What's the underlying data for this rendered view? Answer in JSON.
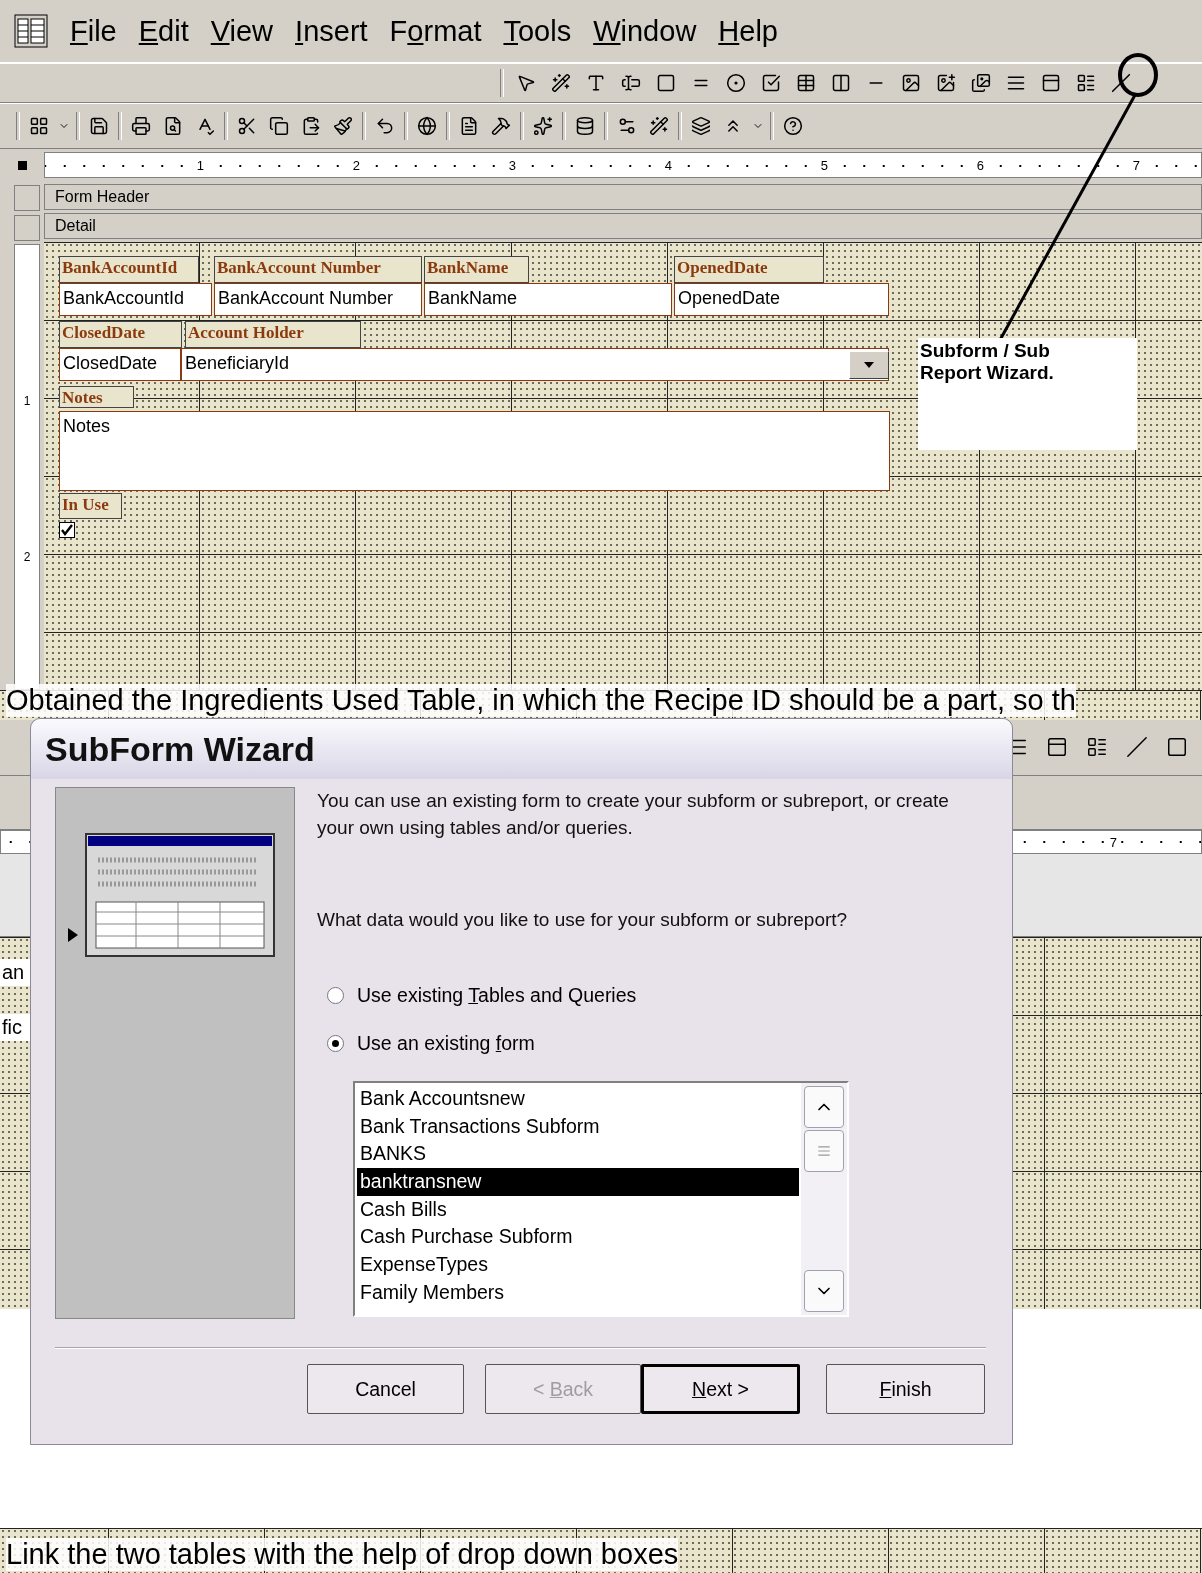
{
  "menu_bar": {
    "items": [
      {
        "key": "F",
        "after": "ile"
      },
      {
        "key": "E",
        "after": "dit"
      },
      {
        "key": "V",
        "after": "iew"
      },
      {
        "key": "I",
        "after": "nsert"
      },
      {
        "before": "F",
        "key": "o",
        "after": "rmat"
      },
      {
        "key": "T",
        "after": "ools"
      },
      {
        "key": "W",
        "after": "indow"
      },
      {
        "key": "H",
        "after": "elp"
      }
    ]
  },
  "ruler": {
    "marks": [
      "1",
      "2",
      "3",
      "4",
      "5",
      "6",
      "7"
    ]
  },
  "vertical_ruler": {
    "marks": [
      "1",
      "2"
    ]
  },
  "sections": [
    {
      "label": "Form Header"
    },
    {
      "label": "Detail"
    }
  ],
  "form": {
    "rows": [
      [
        {
          "kind": "label",
          "text": "BankAccountId"
        },
        {
          "kind": "label",
          "text": "BankAccount Number"
        },
        {
          "kind": "label",
          "text": "BankName"
        },
        {
          "kind": "label",
          "text": "OpenedDate"
        }
      ],
      [
        {
          "kind": "textbox",
          "text": "BankAccountId"
        },
        {
          "kind": "textbox",
          "text": "BankAccount Number"
        },
        {
          "kind": "textbox",
          "text": "BankName"
        },
        {
          "kind": "textbox",
          "text": "OpenedDate"
        }
      ],
      [
        {
          "kind": "label",
          "text": "ClosedDate"
        },
        {
          "kind": "label",
          "text": "Account Holder"
        }
      ],
      [
        {
          "kind": "textbox",
          "text": "ClosedDate"
        },
        {
          "kind": "combo",
          "text": "BeneficiaryId"
        }
      ],
      [
        {
          "kind": "label",
          "text": "Notes"
        }
      ],
      [
        {
          "kind": "memo",
          "text": "Notes"
        }
      ],
      [
        {
          "kind": "label",
          "text": "In Use"
        }
      ],
      [
        {
          "kind": "checkbox",
          "checked": true
        }
      ]
    ]
  },
  "callout": {
    "text": "Subform / Sub Report Wizard."
  },
  "caption_top": "Obtained the Ingredients Used Table, in which the Recipe ID should be a part, so th",
  "behind": {
    "ruler_mark": "7",
    "fragments": [
      "an",
      "fic"
    ]
  },
  "wizard": {
    "title": "SubForm Wizard",
    "intro": "You can use an existing form to create your subform or subreport, or create your own using tables and/or queries.",
    "question": "What data would you like to use for your subform or subreport?",
    "options": [
      {
        "before": "Use existing ",
        "key": "T",
        "after": "ables and Queries",
        "selected": false
      },
      {
        "before": "Use an existing ",
        "key": "f",
        "after": "orm",
        "selected": true
      }
    ],
    "list": [
      {
        "label": "Bank Accountsnew",
        "selected": false
      },
      {
        "label": "Bank Transactions Subform",
        "selected": false
      },
      {
        "label": "BANKS",
        "selected": false
      },
      {
        "label": "banktransnew",
        "selected": true
      },
      {
        "label": "Cash Bills",
        "selected": false
      },
      {
        "label": "Cash Purchase Subform",
        "selected": false
      },
      {
        "label": "ExpenseTypes",
        "selected": false
      },
      {
        "label": "Family Members",
        "selected": false
      }
    ],
    "buttons": [
      {
        "after": "Cancel",
        "disabled": false,
        "default": false
      },
      {
        "before": "< ",
        "key": "B",
        "after": "ack",
        "disabled": true,
        "default": false
      },
      {
        "key": "N",
        "after": "ext >",
        "disabled": false,
        "default": true
      },
      {
        "key": "F",
        "after": "inish",
        "disabled": false,
        "default": false
      }
    ]
  },
  "caption_bottom": "Link  the two tables  with the help of drop down boxes"
}
